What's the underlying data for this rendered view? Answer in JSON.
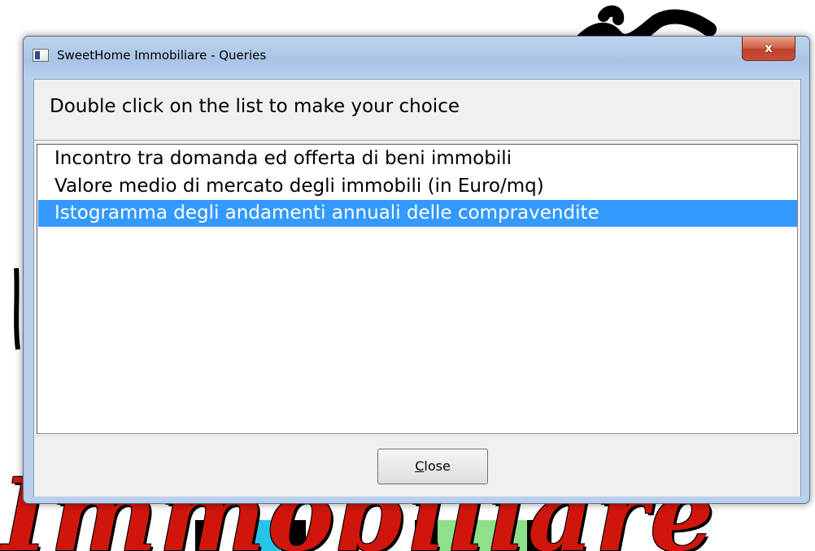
{
  "window": {
    "title": "SweetHome Immobiliare - Queries",
    "close_glyph": "x"
  },
  "header": {
    "instruction": "Double click on the list to make your choice"
  },
  "list": {
    "items": [
      {
        "label": "Incontro tra domanda ed offerta di beni immobili",
        "selected": false
      },
      {
        "label": "Valore medio di mercato degli immobili (in Euro/mq)",
        "selected": false
      },
      {
        "label": "Istogramma degli andamenti annuali delle compravendite",
        "selected": true
      }
    ]
  },
  "footer": {
    "close_mnemonic": "C",
    "close_rest": "lose"
  },
  "background": {
    "word": "Immobiliare",
    "word_color": "#d0160c"
  },
  "colors": {
    "selection": "#3399ff",
    "window_frame": "#a9c4e6",
    "close_button_red": "#c94e38"
  }
}
